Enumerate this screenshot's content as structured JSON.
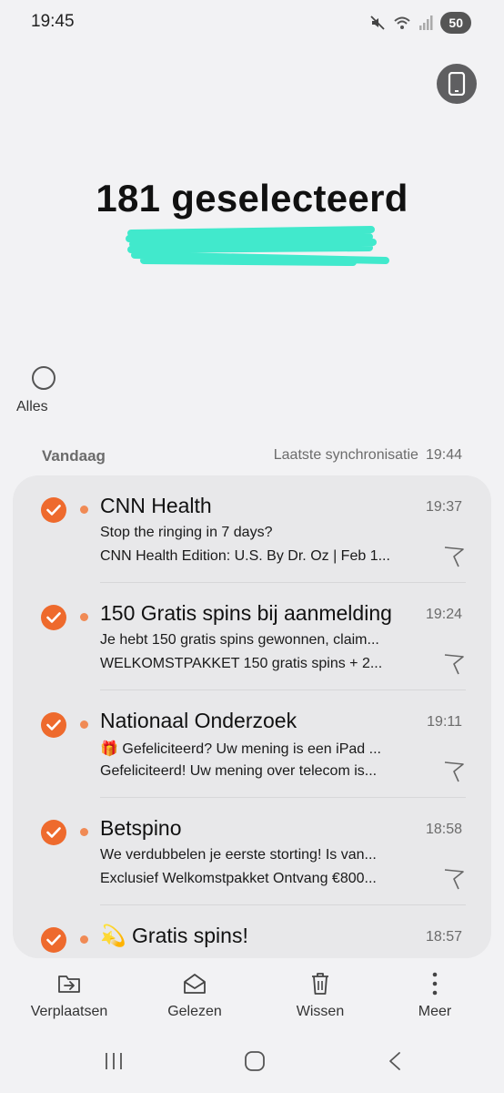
{
  "status_bar": {
    "time": "19:45",
    "battery": "50",
    "icons": [
      "mute-icon",
      "wifi-icon",
      "signal-icon"
    ]
  },
  "header": {
    "title": "181 geselecteerd",
    "device_button_icon": "phone-icon"
  },
  "select_all": {
    "label": "Alles"
  },
  "section": {
    "title": "Vandaag",
    "sync_label": "Laatste synchronisatie",
    "sync_time": "19:44"
  },
  "mails": [
    {
      "sender": "CNN Health",
      "time": "19:37",
      "subject": "Stop the ringing in 7 days?",
      "preview": "CNN Health Edition: U.S.  By Dr. Oz | Feb 1..."
    },
    {
      "sender": "150 Gratis spins bij aanmelding",
      "time": "19:24",
      "subject": "Je hebt 150 gratis spins gewonnen, claim...",
      "preview": "WELKOMSTPAKKET  150 gratis spins  + 2..."
    },
    {
      "sender": "Nationaal Onderzoek",
      "time": "19:11",
      "subject": "🎁 Gefeliciteerd? Uw mening is een iPad ...",
      "preview": "Gefeliciteerd! Uw mening over telecom is..."
    },
    {
      "sender": "Betspino",
      "time": "18:58",
      "subject": "We verdubbelen je eerste storting! Is van...",
      "preview": "Exclusief Welkomstpakket  Ontvang €800..."
    },
    {
      "sender": "💫 Gratis spins!",
      "time": "18:57",
      "subject": "",
      "preview": ""
    }
  ],
  "actions": {
    "move": "Verplaatsen",
    "read": "Gelezen",
    "delete": "Wissen",
    "more": "Meer"
  },
  "colors": {
    "accent": "#ee6a2d",
    "unread_dot": "#f08a55",
    "scribble": "#2de8c8",
    "card_bg": "#e8e8ea",
    "page_bg": "#f2f2f4"
  }
}
